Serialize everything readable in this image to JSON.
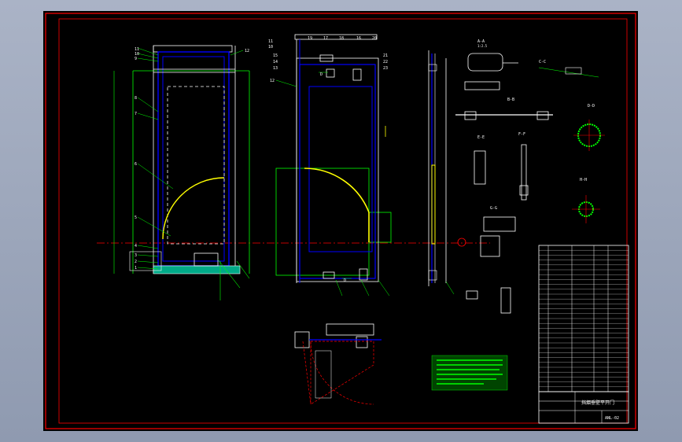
{
  "colors": {
    "background": "#000000",
    "frame": "#ff0000",
    "geometry": "#ffffff",
    "outline": "#00ff00",
    "panel": "#0000ff",
    "arc": "#ffff00",
    "centerline": "#ff0000",
    "leader": "#00ff00"
  },
  "views": {
    "main_view": {
      "balloons": [
        "11",
        "10",
        "9",
        "8",
        "7",
        "6",
        "5",
        "4",
        "3",
        "2",
        "1",
        "12"
      ]
    },
    "side_view": {
      "balloons": [
        "11",
        "10",
        "15",
        "14",
        "13",
        "19",
        "17",
        "18",
        "16",
        "20",
        "21",
        "22",
        "23",
        "12"
      ],
      "section_marks": [
        "D",
        "D"
      ]
    },
    "sections": {
      "a_a": "A-A",
      "b_b": "B-B",
      "c_c": "C-C",
      "d_d": "D-D",
      "e_e": "E-E",
      "f_f": "F-F",
      "g_g": "G-G",
      "h_h": "H-H",
      "scale": "1:2.5"
    }
  },
  "title_block": {
    "title": "挡烟垂壁平开门",
    "drawing_no": "ANL-02"
  }
}
